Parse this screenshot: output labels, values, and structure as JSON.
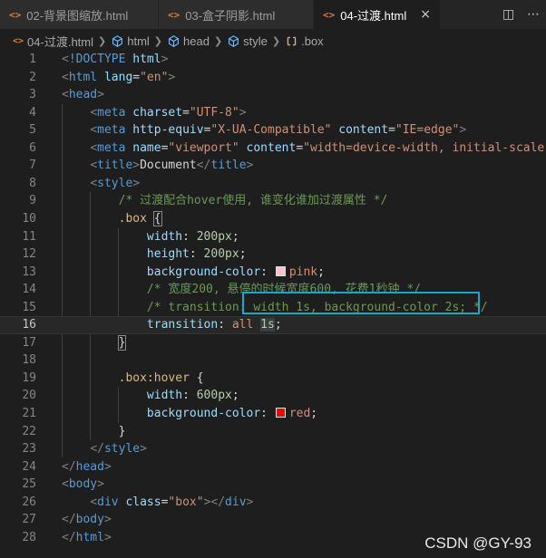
{
  "tabs": [
    {
      "label": "02-背景图缩放.html",
      "icon": "html-icon",
      "active": false
    },
    {
      "label": "03-盒子阴影.html",
      "icon": "html-icon",
      "active": false
    },
    {
      "label": "04-过渡.html",
      "icon": "html-icon",
      "active": true
    }
  ],
  "tab_icon_glyph": "<>",
  "close_glyph": "×",
  "tab_actions": {
    "split_glyph": "◫",
    "more_glyph": "⋯"
  },
  "breadcrumb": [
    {
      "label": "04-过渡.html",
      "icon": "html-icon"
    },
    {
      "label": "html",
      "icon": "element-icon"
    },
    {
      "label": "head",
      "icon": "element-icon"
    },
    {
      "label": "style",
      "icon": "element-icon"
    },
    {
      "label": ".box",
      "icon": "selector-icon"
    }
  ],
  "editor": {
    "current_line": 16,
    "swatches": {
      "pink": "#ffc0cb",
      "red": "#ff0000"
    },
    "lines": [
      {
        "n": "1",
        "tokens": [
          [
            "t-punc",
            "<"
          ],
          [
            "t-tag",
            "!DOCTYPE"
          ],
          [
            "t-text",
            " "
          ],
          [
            "t-attr",
            "html"
          ],
          [
            "t-punc",
            ">"
          ]
        ]
      },
      {
        "n": "2",
        "tokens": [
          [
            "t-punc",
            "<"
          ],
          [
            "t-tag",
            "html"
          ],
          [
            "t-text",
            " "
          ],
          [
            "t-attr",
            "lang"
          ],
          [
            "t-text",
            "="
          ],
          [
            "t-str",
            "\"en\""
          ],
          [
            "t-punc",
            ">"
          ]
        ]
      },
      {
        "n": "3",
        "tokens": [
          [
            "t-punc",
            "<"
          ],
          [
            "t-tag",
            "head"
          ],
          [
            "t-punc",
            ">"
          ]
        ]
      },
      {
        "n": "4",
        "tokens": [
          [
            "t-text",
            "    "
          ],
          [
            "t-punc",
            "<"
          ],
          [
            "t-tag",
            "meta"
          ],
          [
            "t-text",
            " "
          ],
          [
            "t-attr",
            "charset"
          ],
          [
            "t-text",
            "="
          ],
          [
            "t-str",
            "\"UTF-8\""
          ],
          [
            "t-punc",
            ">"
          ]
        ]
      },
      {
        "n": "5",
        "tokens": [
          [
            "t-text",
            "    "
          ],
          [
            "t-punc",
            "<"
          ],
          [
            "t-tag",
            "meta"
          ],
          [
            "t-text",
            " "
          ],
          [
            "t-attr",
            "http-equiv"
          ],
          [
            "t-text",
            "="
          ],
          [
            "t-str",
            "\"X-UA-Compatible\""
          ],
          [
            "t-text",
            " "
          ],
          [
            "t-attr",
            "content"
          ],
          [
            "t-text",
            "="
          ],
          [
            "t-str",
            "\"IE=edge\""
          ],
          [
            "t-punc",
            ">"
          ]
        ]
      },
      {
        "n": "6",
        "tokens": [
          [
            "t-text",
            "    "
          ],
          [
            "t-punc",
            "<"
          ],
          [
            "t-tag",
            "meta"
          ],
          [
            "t-text",
            " "
          ],
          [
            "t-attr",
            "name"
          ],
          [
            "t-text",
            "="
          ],
          [
            "t-str",
            "\"viewport\""
          ],
          [
            "t-text",
            " "
          ],
          [
            "t-attr",
            "content"
          ],
          [
            "t-text",
            "="
          ],
          [
            "t-str",
            "\"width=device-width, initial-scale"
          ]
        ]
      },
      {
        "n": "7",
        "tokens": [
          [
            "t-text",
            "    "
          ],
          [
            "t-punc",
            "<"
          ],
          [
            "t-tag",
            "title"
          ],
          [
            "t-punc",
            ">"
          ],
          [
            "t-text",
            "Document"
          ],
          [
            "t-punc",
            "</"
          ],
          [
            "t-tag",
            "title"
          ],
          [
            "t-punc",
            ">"
          ]
        ]
      },
      {
        "n": "8",
        "tokens": [
          [
            "t-text",
            "    "
          ],
          [
            "t-punc",
            "<"
          ],
          [
            "t-tag",
            "style"
          ],
          [
            "t-punc",
            ">"
          ]
        ]
      },
      {
        "n": "9",
        "tokens": [
          [
            "t-text",
            "        "
          ],
          [
            "t-com",
            "/* 过渡配合hover使用, 谁变化谁加过渡属性 */"
          ]
        ]
      },
      {
        "n": "10",
        "tokens": [
          [
            "t-text",
            "        "
          ],
          [
            "t-sel",
            ".box"
          ],
          [
            "t-text",
            " "
          ],
          [
            "t-text bracket-hl",
            "{"
          ]
        ]
      },
      {
        "n": "11",
        "tokens": [
          [
            "t-text",
            "            "
          ],
          [
            "t-prop",
            "width"
          ],
          [
            "t-text",
            ": "
          ],
          [
            "t-num",
            "200px"
          ],
          [
            "t-text",
            ";"
          ]
        ]
      },
      {
        "n": "12",
        "tokens": [
          [
            "t-text",
            "            "
          ],
          [
            "t-prop",
            "height"
          ],
          [
            "t-text",
            ": "
          ],
          [
            "t-num",
            "200px"
          ],
          [
            "t-text",
            ";"
          ]
        ]
      },
      {
        "n": "13",
        "tokens": [
          [
            "t-text",
            "            "
          ],
          [
            "t-prop",
            "background-color"
          ],
          [
            "t-text",
            ": "
          ],
          [
            "swatch",
            "pink"
          ],
          [
            "t-val",
            "pink"
          ],
          [
            "t-text",
            ";"
          ]
        ]
      },
      {
        "n": "14",
        "tokens": [
          [
            "t-text",
            "            "
          ],
          [
            "t-com",
            "/* 宽度200, 悬停的时候宽度600, 花费1秒钟 */"
          ]
        ]
      },
      {
        "n": "15",
        "tokens": [
          [
            "t-text",
            "            "
          ],
          [
            "t-com",
            "/* transition: width 1s, background-color 2s; */"
          ]
        ]
      },
      {
        "n": "16",
        "tokens": [
          [
            "t-text",
            "            "
          ],
          [
            "t-prop",
            "transition"
          ],
          [
            "t-text",
            ": "
          ],
          [
            "t-val",
            "all"
          ],
          [
            "t-text",
            " "
          ],
          [
            "t-num word-hl",
            "1s"
          ],
          [
            "t-text",
            ";"
          ]
        ]
      },
      {
        "n": "17",
        "tokens": [
          [
            "t-text",
            "        "
          ],
          [
            "t-text bracket-hl",
            "}"
          ]
        ]
      },
      {
        "n": "18",
        "tokens": []
      },
      {
        "n": "19",
        "tokens": [
          [
            "t-text",
            "        "
          ],
          [
            "t-sel",
            ".box:hover"
          ],
          [
            "t-text",
            " {"
          ]
        ]
      },
      {
        "n": "20",
        "tokens": [
          [
            "t-text",
            "            "
          ],
          [
            "t-prop",
            "width"
          ],
          [
            "t-text",
            ": "
          ],
          [
            "t-num",
            "600px"
          ],
          [
            "t-text",
            ";"
          ]
        ]
      },
      {
        "n": "21",
        "tokens": [
          [
            "t-text",
            "            "
          ],
          [
            "t-prop",
            "background-color"
          ],
          [
            "t-text",
            ": "
          ],
          [
            "swatch",
            "red"
          ],
          [
            "t-val",
            "red"
          ],
          [
            "t-text",
            ";"
          ]
        ]
      },
      {
        "n": "22",
        "tokens": [
          [
            "t-text",
            "        }"
          ]
        ]
      },
      {
        "n": "23",
        "tokens": [
          [
            "t-text",
            "    "
          ],
          [
            "t-punc",
            "</"
          ],
          [
            "t-tag",
            "style"
          ],
          [
            "t-punc",
            ">"
          ]
        ]
      },
      {
        "n": "24",
        "tokens": [
          [
            "t-punc",
            "</"
          ],
          [
            "t-tag",
            "head"
          ],
          [
            "t-punc",
            ">"
          ]
        ]
      },
      {
        "n": "25",
        "tokens": [
          [
            "t-punc",
            "<"
          ],
          [
            "t-tag",
            "body"
          ],
          [
            "t-punc",
            ">"
          ]
        ]
      },
      {
        "n": "26",
        "tokens": [
          [
            "t-text",
            "    "
          ],
          [
            "t-punc",
            "<"
          ],
          [
            "t-tag",
            "div"
          ],
          [
            "t-text",
            " "
          ],
          [
            "t-attr",
            "class"
          ],
          [
            "t-text",
            "="
          ],
          [
            "t-str",
            "\"box\""
          ],
          [
            "t-punc",
            "></"
          ],
          [
            "t-tag",
            "div"
          ],
          [
            "t-punc",
            ">"
          ]
        ]
      },
      {
        "n": "27",
        "tokens": [
          [
            "t-punc",
            "</"
          ],
          [
            "t-tag",
            "body"
          ],
          [
            "t-punc",
            ">"
          ]
        ]
      },
      {
        "n": "28",
        "tokens": [
          [
            "t-punc",
            "</"
          ],
          [
            "t-tag",
            "html"
          ],
          [
            "t-punc",
            ">"
          ]
        ]
      }
    ]
  },
  "watermark": "CSDN @GY-93"
}
